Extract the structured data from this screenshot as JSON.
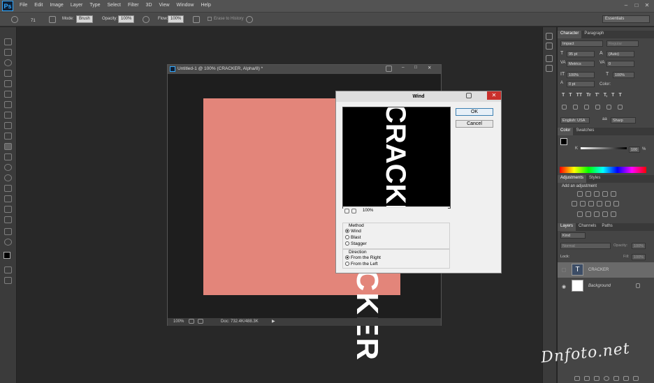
{
  "app": {
    "logo": "Ps"
  },
  "menu": [
    "File",
    "Edit",
    "Image",
    "Layer",
    "Type",
    "Select",
    "Filter",
    "3D",
    "View",
    "Window",
    "Help"
  ],
  "options": {
    "brush_size": "71",
    "mode_label": "Mode:",
    "mode_value": "Brush",
    "opacity_label": "Opacity:",
    "opacity_value": "100%",
    "flow_label": "Flow:",
    "flow_value": "100%",
    "erase_to_history": "Erase to History",
    "workspace": "Essentials"
  },
  "document": {
    "tab_title": "Untitled-1 @ 100% (CRACKER, Alpha/8) *",
    "text": "CRACKER",
    "zoom": "100%",
    "doc_size": "Doc: 732.4K/488.3K"
  },
  "dialog": {
    "title": "Wind",
    "ok": "OK",
    "cancel": "Cancel",
    "preview_zoom": "100%",
    "method_label": "Method",
    "methods": [
      "Wind",
      "Blast",
      "Stagger"
    ],
    "method_selected": "Wind",
    "direction_label": "Direction",
    "directions": [
      "From the Right",
      "From the Left"
    ],
    "direction_selected": "From the Right"
  },
  "character_panel": {
    "tabs": [
      "Character",
      "Paragraph"
    ],
    "font_family": "Impact",
    "font_style": "Regular",
    "font_size": "95 pt",
    "leading": "(Auto)",
    "kerning": "Metrics",
    "tracking": "0",
    "vscale": "100%",
    "hscale": "100%",
    "baseline": "0 pt",
    "color_label": "Color:",
    "language": "English: USA",
    "antialias": "Sharp",
    "type_buttons": [
      "T",
      "T",
      "TT",
      "Tr",
      "T'",
      "T,",
      "T",
      "T"
    ]
  },
  "color_panel": {
    "tabs": [
      "Color",
      "Swatches"
    ],
    "k_label": "K",
    "k_value": "100",
    "k_unit": "%"
  },
  "adjustments_panel": {
    "tabs": [
      "Adjustments",
      "Styles"
    ],
    "heading": "Add an adjustment"
  },
  "layers_panel": {
    "tabs": [
      "Layers",
      "Channels",
      "Paths"
    ],
    "filter": "Kind",
    "blend": "Normal",
    "opacity_label": "Opacity:",
    "opacity_value": "100%",
    "lock_label": "Lock:",
    "fill_label": "Fill:",
    "fill_value": "100%",
    "layers": [
      {
        "name": "CRACKER",
        "type": "text"
      },
      {
        "name": "Background",
        "type": "background"
      }
    ]
  },
  "watermark": "Dnfoto.net"
}
